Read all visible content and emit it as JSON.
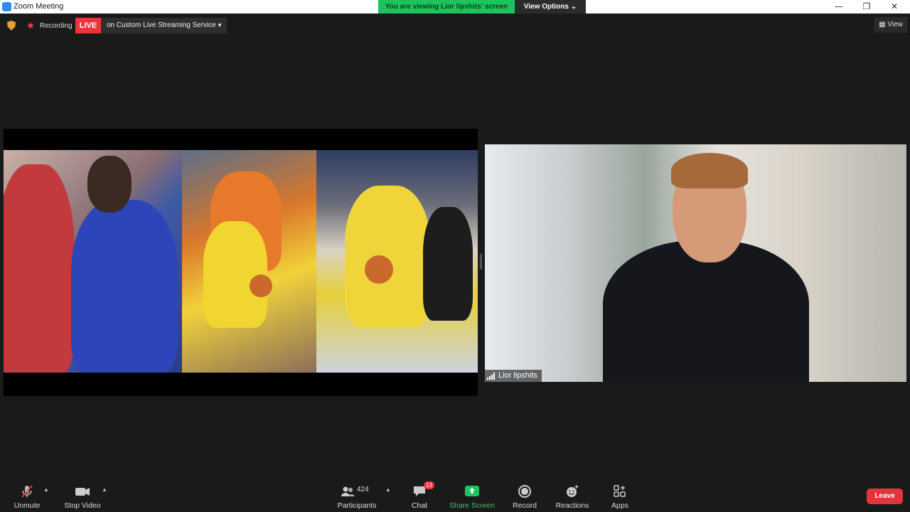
{
  "window": {
    "title": "Zoom Meeting"
  },
  "banner": {
    "viewing_text": "You are viewing Lior lipshits' screen",
    "view_options": "View Options ⌄"
  },
  "topbar": {
    "recording_label": "Recording",
    "live_badge": "LIVE",
    "stream_label": "on Custom Live Streaming Service",
    "view_label": "View"
  },
  "speaker": {
    "name": "Lior lipshits"
  },
  "toolbar": {
    "unmute": "Unmute",
    "stop_video": "Stop Video",
    "participants": "Participants",
    "participants_count": "424",
    "chat": "Chat",
    "chat_badge": "13",
    "share_screen": "Share Screen",
    "record": "Record",
    "reactions": "Reactions",
    "apps": "Apps",
    "leave": "Leave"
  },
  "colors": {
    "live": "#e8363d",
    "share_green": "#1fc35e",
    "leave": "#e0353a"
  }
}
